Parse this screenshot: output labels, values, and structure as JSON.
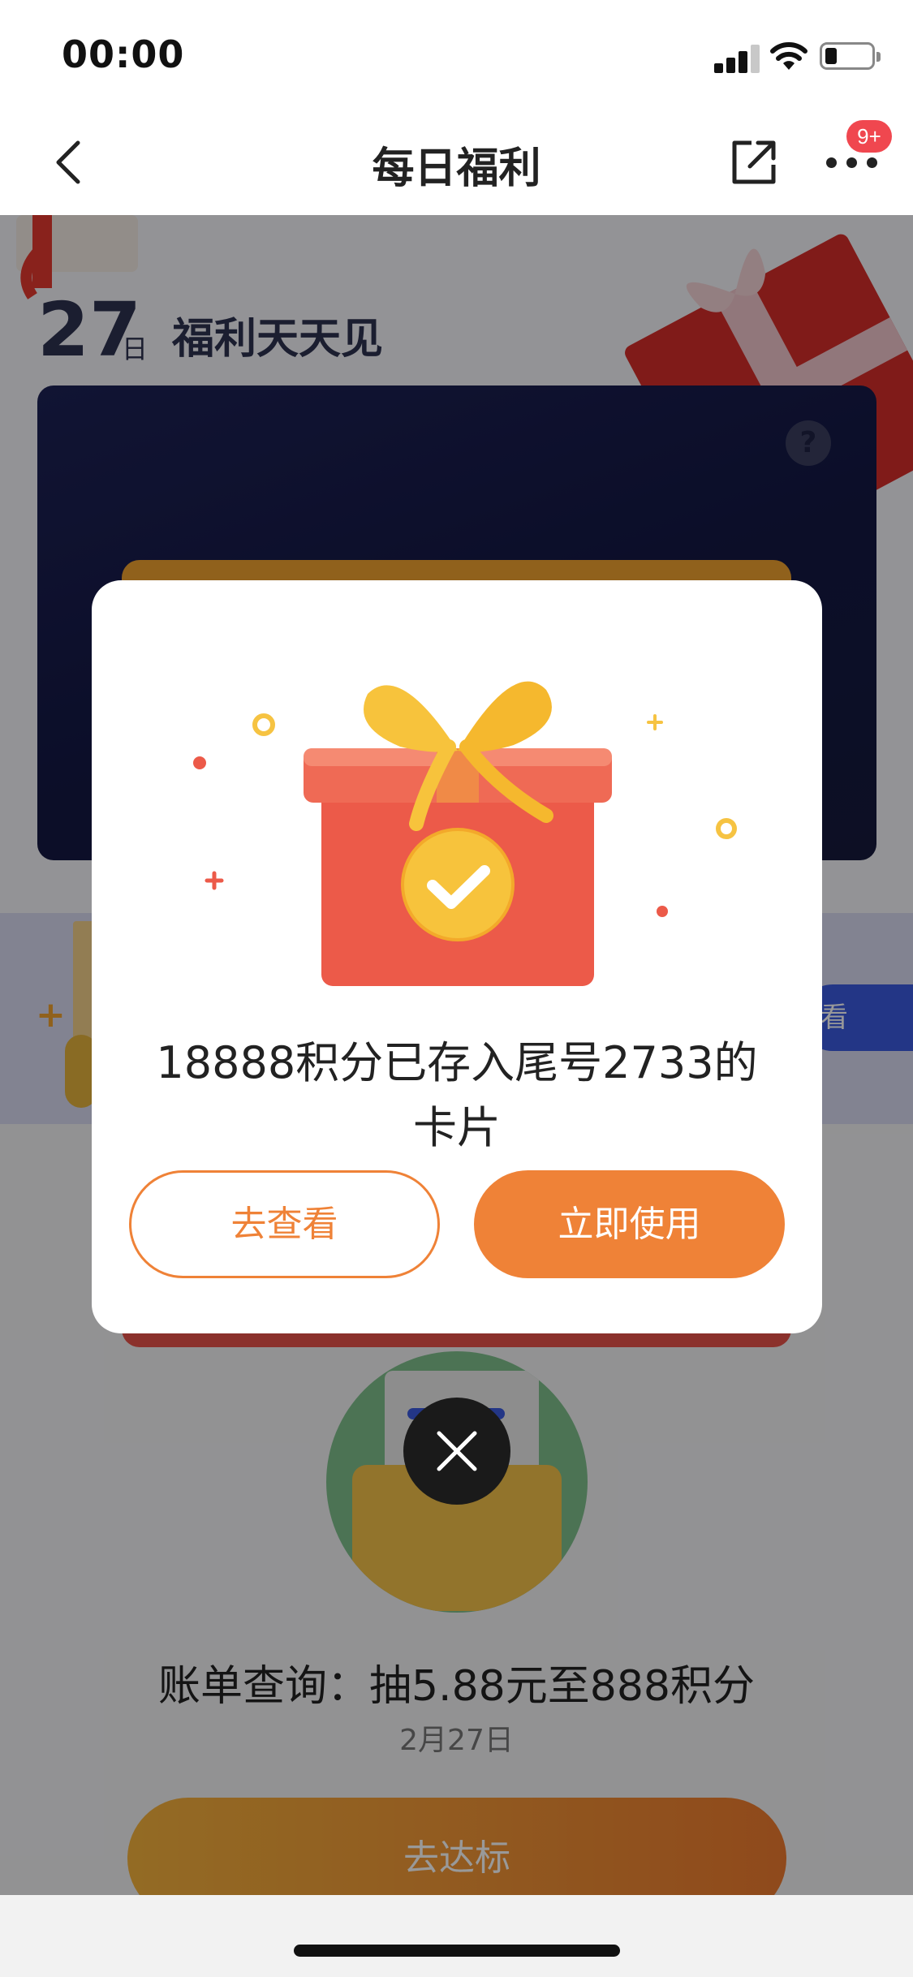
{
  "status_bar": {
    "time": "00:00"
  },
  "nav": {
    "title": "每日福利",
    "badge": "9+"
  },
  "hero": {
    "date_number": "27",
    "date_unit": "日",
    "slogan": "福利天天见",
    "help_symbol": "?"
  },
  "promo": {
    "plus_symbol": "+",
    "button_label": "看"
  },
  "task": {
    "title": "账单查询：抽5.88元至888积分",
    "date": "2月27日",
    "button_label": "去达标"
  },
  "modal": {
    "message": "18888积分已存入尾号2733的卡片",
    "view_button": "去查看",
    "use_button": "立即使用"
  },
  "icons": {
    "back": "chevron-left-icon",
    "share": "share-icon",
    "more": "more-dots-icon",
    "close": "close-icon",
    "gift": "gift-box-icon"
  },
  "colors": {
    "accent_orange": "#ef8237",
    "badge_red": "#f0474f",
    "gift_red": "#ec5a49",
    "ribbon_yellow": "#f7c33c",
    "dark_card": "#161a45"
  }
}
